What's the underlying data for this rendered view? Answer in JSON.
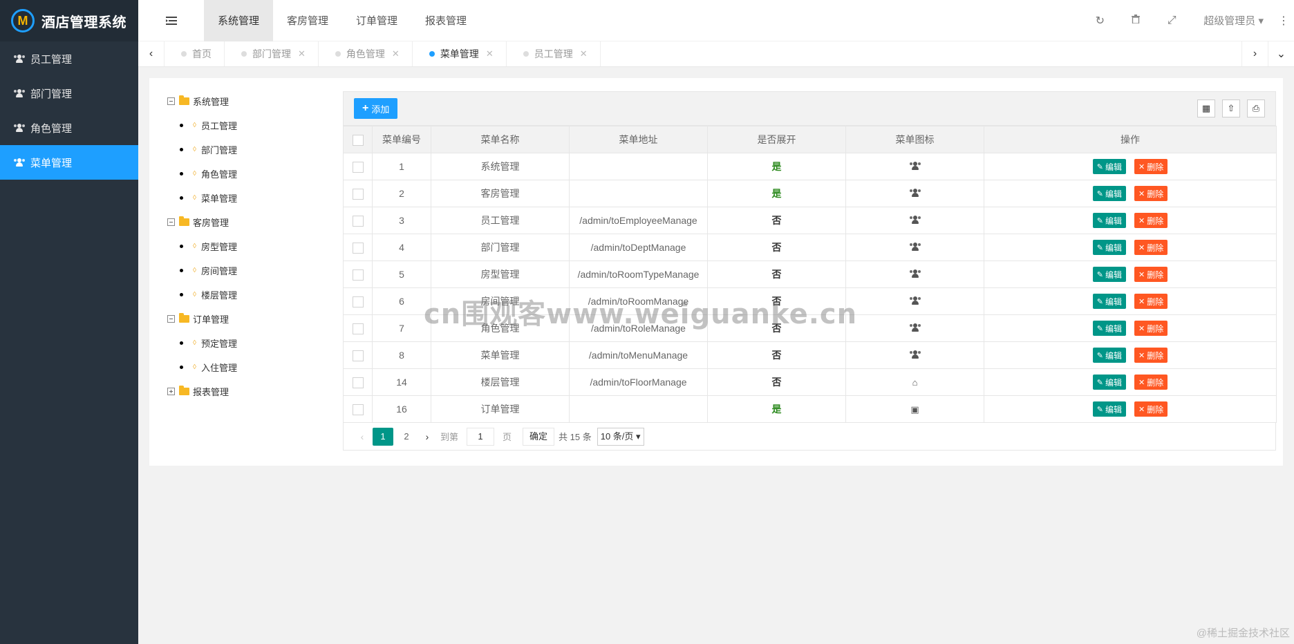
{
  "app": {
    "title": "酒店管理系统",
    "logo_letter": "M"
  },
  "sidebar": {
    "items": [
      {
        "label": "员工管理",
        "active": false
      },
      {
        "label": "部门管理",
        "active": false
      },
      {
        "label": "角色管理",
        "active": false
      },
      {
        "label": "菜单管理",
        "active": true
      }
    ]
  },
  "header": {
    "nav": [
      "系统管理",
      "客房管理",
      "订单管理",
      "报表管理"
    ],
    "user": "超级管理员",
    "icons": [
      "refresh-icon",
      "trash-icon",
      "fullscreen-icon",
      "more-icon"
    ]
  },
  "tabs": [
    {
      "label": "首页",
      "closable": false,
      "active": false
    },
    {
      "label": "部门管理",
      "closable": true,
      "active": false
    },
    {
      "label": "角色管理",
      "closable": true,
      "active": false
    },
    {
      "label": "菜单管理",
      "closable": true,
      "active": true
    },
    {
      "label": "员工管理",
      "closable": true,
      "active": false
    }
  ],
  "tree": {
    "groups": [
      {
        "label": "系统管理",
        "expanded": true,
        "children": [
          "员工管理",
          "部门管理",
          "角色管理",
          "菜单管理"
        ]
      },
      {
        "label": "客房管理",
        "expanded": true,
        "children": [
          "房型管理",
          "房间管理",
          "楼层管理"
        ]
      },
      {
        "label": "订单管理",
        "expanded": true,
        "children": [
          "预定管理",
          "入住管理"
        ]
      },
      {
        "label": "报表管理",
        "expanded": false,
        "children": []
      }
    ]
  },
  "toolbar": {
    "add_label": "添加"
  },
  "table": {
    "columns": [
      "菜单编号",
      "菜单名称",
      "菜单地址",
      "是否展开",
      "菜单图标",
      "操作"
    ],
    "edit_label": "编辑",
    "delete_label": "删除",
    "rows": [
      {
        "id": "1",
        "name": "系统管理",
        "url": "",
        "open": "是",
        "icon": "users-icon"
      },
      {
        "id": "2",
        "name": "客房管理",
        "url": "",
        "open": "是",
        "icon": "users-icon"
      },
      {
        "id": "3",
        "name": "员工管理",
        "url": "/admin/toEmployeeManage",
        "open": "否",
        "icon": "users-icon"
      },
      {
        "id": "4",
        "name": "部门管理",
        "url": "/admin/toDeptManage",
        "open": "否",
        "icon": "users-icon"
      },
      {
        "id": "5",
        "name": "房型管理",
        "url": "/admin/toRoomTypeManage",
        "open": "否",
        "icon": "users-icon"
      },
      {
        "id": "6",
        "name": "房间管理",
        "url": "/admin/toRoomManage",
        "open": "否",
        "icon": "users-icon"
      },
      {
        "id": "7",
        "name": "角色管理",
        "url": "/admin/toRoleManage",
        "open": "否",
        "icon": "users-icon"
      },
      {
        "id": "8",
        "name": "菜单管理",
        "url": "/admin/toMenuManage",
        "open": "否",
        "icon": "users-icon"
      },
      {
        "id": "14",
        "name": "楼层管理",
        "url": "/admin/toFloorManage",
        "open": "否",
        "icon": "home-icon"
      },
      {
        "id": "16",
        "name": "订单管理",
        "url": "",
        "open": "是",
        "icon": "contact-icon"
      }
    ]
  },
  "pager": {
    "pages": [
      "1",
      "2"
    ],
    "current": "1",
    "goto_prefix": "到第",
    "goto_value": "1",
    "goto_suffix": "页",
    "confirm_label": "确定",
    "total_text": "共 15 条",
    "page_size": "10 条/页"
  },
  "watermark": "cn围观客www.weiguanke.cn",
  "footer_mark": "@稀土掘金技术社区",
  "colors": {
    "sidebar": "#28333e",
    "accent": "#1e9fff",
    "edit": "#009688",
    "delete": "#ff5722",
    "yes": "#2e8b20"
  }
}
